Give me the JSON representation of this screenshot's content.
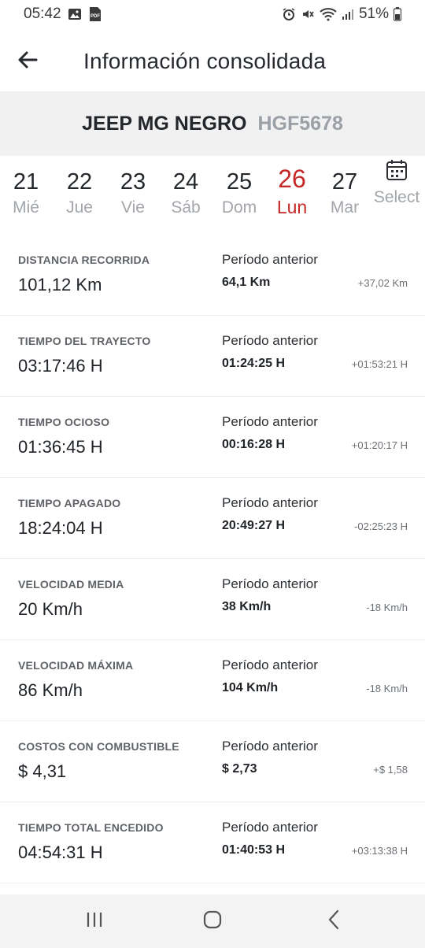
{
  "status_bar": {
    "time": "05:42",
    "battery": "51%",
    "icons": [
      "image-icon",
      "pdf-icon",
      "alarm-icon",
      "mute-icon",
      "wifi-icon",
      "signal-icon",
      "battery-icon"
    ],
    "pdf_text": "PDF"
  },
  "header": {
    "title": "Información consolidada",
    "back_icon": "arrow-left-icon"
  },
  "vehicle": {
    "name": "JEEP MG NEGRO",
    "plate": "HGF5678"
  },
  "dates": [
    {
      "num": "21",
      "name": "Mié",
      "selected": false
    },
    {
      "num": "22",
      "name": "Jue",
      "selected": false
    },
    {
      "num": "23",
      "name": "Vie",
      "selected": false
    },
    {
      "num": "24",
      "name": "Sáb",
      "selected": false
    },
    {
      "num": "25",
      "name": "Dom",
      "selected": false
    },
    {
      "num": "26",
      "name": "Lun",
      "selected": true
    },
    {
      "num": "27",
      "name": "Mar",
      "selected": false
    }
  ],
  "date_select": {
    "label": "Select",
    "icon": "calendar-icon"
  },
  "metrics": [
    {
      "label": "DISTANCIA RECORRIDA",
      "value": "101,12 Km",
      "prev_label": "Período anterior",
      "prev_value": "64,1 Km",
      "delta": "+37,02 Km"
    },
    {
      "label": "TIEMPO DEL TRAYECTO",
      "value": "03:17:46 H",
      "prev_label": "Período anterior",
      "prev_value": "01:24:25 H",
      "delta": "+01:53:21 H"
    },
    {
      "label": "TIEMPO OCIOSO",
      "value": "01:36:45 H",
      "prev_label": "Período anterior",
      "prev_value": "00:16:28 H",
      "delta": "+01:20:17 H"
    },
    {
      "label": "TIEMPO APAGADO",
      "value": "18:24:04 H",
      "prev_label": "Período anterior",
      "prev_value": "20:49:27 H",
      "delta": "-02:25:23 H"
    },
    {
      "label": "VELOCIDAD MEDIA",
      "value": "20 Km/h",
      "prev_label": "Período anterior",
      "prev_value": "38 Km/h",
      "delta": "-18 Km/h"
    },
    {
      "label": "VELOCIDAD MÁXIMA",
      "value": "86 Km/h",
      "prev_label": "Período anterior",
      "prev_value": "104 Km/h",
      "delta": "-18 Km/h"
    },
    {
      "label": "COSTOS CON COMBUSTIBLE",
      "value": "$ 4,31",
      "prev_label": "Período anterior",
      "prev_value": "$ 2,73",
      "delta": "+$ 1,58"
    },
    {
      "label": "TIEMPO TOTAL ENCEDIDO",
      "value": "04:54:31 H",
      "prev_label": "Período anterior",
      "prev_value": "01:40:53 H",
      "delta": "+03:13:38 H"
    }
  ],
  "nav": {
    "recents_icon": "recent-apps-icon",
    "home_icon": "home-icon",
    "back_icon": "nav-back-icon"
  },
  "colors": {
    "accent": "#c62828",
    "banner_bg": "#f1f1f1",
    "muted": "#a2a6aa"
  }
}
